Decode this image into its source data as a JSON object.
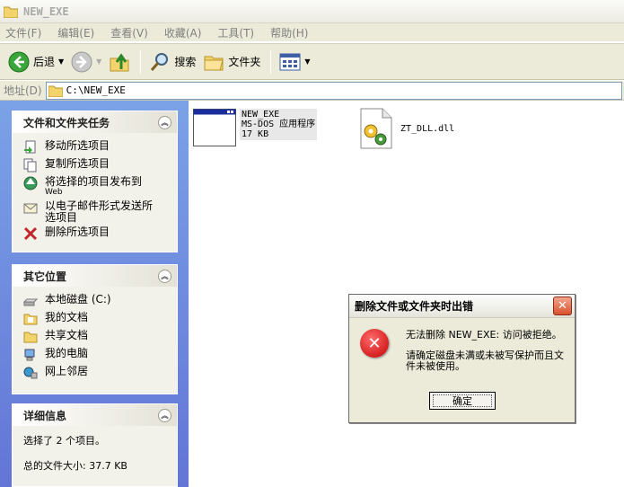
{
  "window": {
    "title": "NEW_EXE"
  },
  "menu": [
    "文件(F)",
    "编辑(E)",
    "查看(V)",
    "收藏(A)",
    "工具(T)",
    "帮助(H)"
  ],
  "toolbar": {
    "back": "后退",
    "search": "搜索",
    "folders": "文件夹"
  },
  "address": {
    "label": "地址(D)",
    "value": "C:\\NEW_EXE"
  },
  "tasks_panel": {
    "title": "文件和文件夹任务",
    "items": [
      {
        "label": "移动所选项目",
        "sub": ""
      },
      {
        "label": "复制所选项目",
        "sub": ""
      },
      {
        "label": "将选择的项目发布到",
        "sub": "Web"
      },
      {
        "label": "以电子邮件形式发送所",
        "sub": "选项目"
      },
      {
        "label": "删除所选项目",
        "sub": ""
      }
    ]
  },
  "places_panel": {
    "title": "其它位置",
    "items": [
      "本地磁盘 (C:)",
      "我的文档",
      "共享文档",
      "我的电脑",
      "网上邻居"
    ]
  },
  "details_panel": {
    "title": "详细信息",
    "line1": "选择了 2 个项目。",
    "line2": "总的文件大小: 37.7 KB"
  },
  "files": [
    {
      "name": "NEW_EXE",
      "type": "MS-DOS 应用程序",
      "size": "17 KB"
    },
    {
      "name": "ZT_DLL.dll"
    }
  ],
  "dialog": {
    "title": "删除文件或文件夹时出错",
    "message": "无法删除 NEW_EXE: 访问被拒绝。",
    "detail": "请确定磁盘未满或未被写保护而且文件未被使用。",
    "ok": "确定"
  },
  "colors": {
    "task_link": "#215dc6",
    "panel_bg": "#7ba2e7",
    "error_red": "#c40000"
  }
}
